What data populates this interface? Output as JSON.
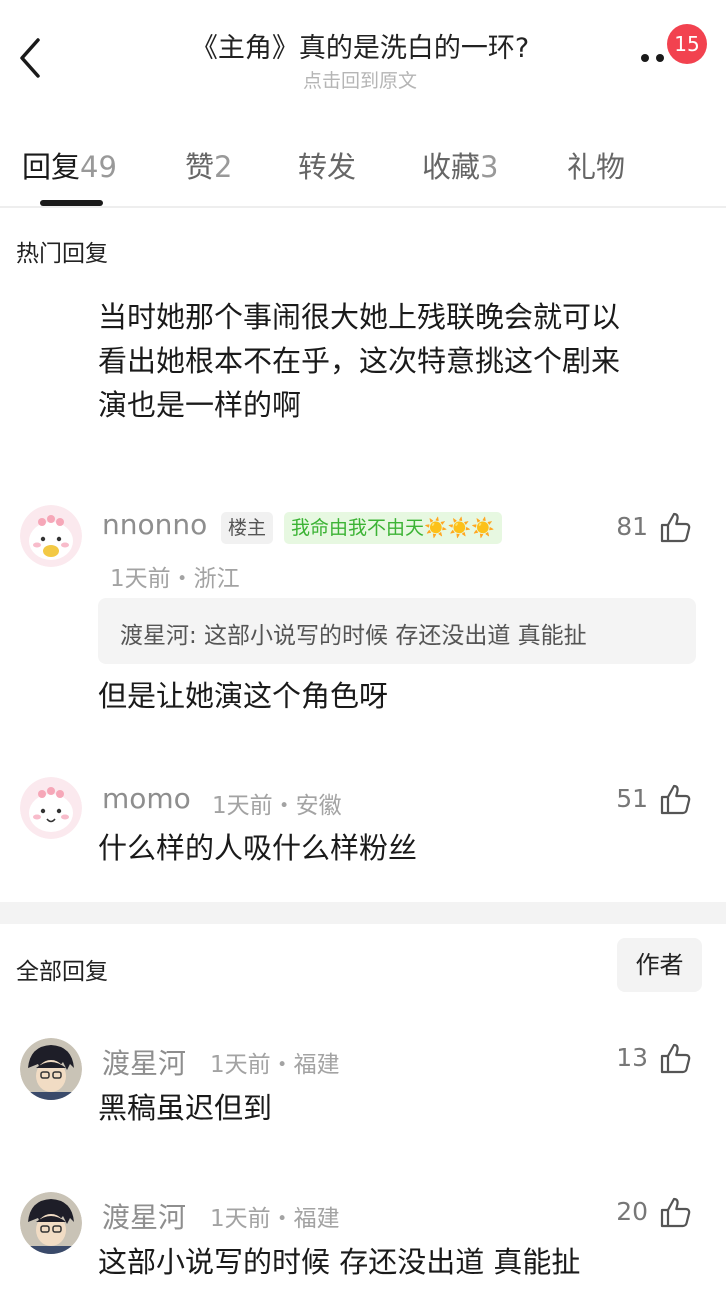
{
  "header": {
    "title": "《主角》真的是洗白的一环?",
    "subtitle": "点击回到原文",
    "notification_count": "15"
  },
  "tabs": [
    {
      "label": "回复",
      "count": "49"
    },
    {
      "label": "赞",
      "count": "2"
    },
    {
      "label": "转发",
      "count": ""
    },
    {
      "label": "收藏",
      "count": "3"
    },
    {
      "label": "礼物",
      "count": ""
    }
  ],
  "hot_section": {
    "label": "热门回复",
    "post_text": [
      "当时她那个事闹很大她上残联晚会就可以",
      "看出她根本不在乎，这次特意挑这个剧来",
      "演也是一样的啊"
    ],
    "comments": [
      {
        "username": "nnonno",
        "owner_tag": "楼主",
        "title_tag": "我命由我不由天☀️☀️☀️",
        "meta": "1天前・浙江",
        "likes": "81",
        "quote": "渡星河: 这部小说写的时候 存还没出道 真能扯",
        "text": "但是让她演这个角色呀"
      },
      {
        "username": "momo",
        "meta": "1天前・安徽",
        "likes": "51",
        "text": "什么样的人吸什么样粉丝"
      }
    ]
  },
  "all_section": {
    "label": "全部回复",
    "author_filter": "作者",
    "comments": [
      {
        "username": "渡星河",
        "meta": "1天前・福建",
        "likes": "13",
        "text": "黑稿虽迟但到"
      },
      {
        "username": "渡星河",
        "meta": "1天前・福建",
        "likes": "20",
        "text": "这部小说写的时候 存还没出道 真能扯"
      }
    ]
  },
  "colors": {
    "badge": "#f2424f",
    "title_tag_text": "#3cb335",
    "title_tag_bg": "#e7f8e1"
  },
  "icons": [
    "back-icon",
    "more-icon",
    "thumb-up-icon"
  ]
}
